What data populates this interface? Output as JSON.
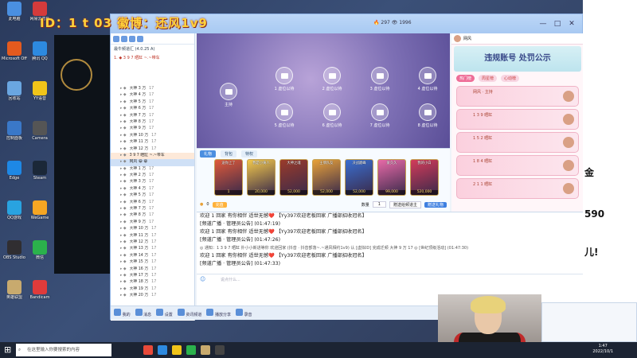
{
  "stream_overlay": {
    "text": "ID：1 t 03 徽博：还风1v9"
  },
  "desktop_icons": [
    {
      "label": "此电脑",
      "color": "#4a8fe0"
    },
    {
      "label": "网易云音乐",
      "color": "#d43b3b"
    },
    {
      "label": "Microsoft Office",
      "color": "#e45a1e"
    },
    {
      "label": "腾讯 QQ",
      "color": "#2d8ae0"
    },
    {
      "label": "回收站",
      "color": "#6aa6e0"
    },
    {
      "label": "YY语音",
      "color": "#f0c419"
    },
    {
      "label": "控制面板",
      "color": "#3a78c8"
    },
    {
      "label": "Camera",
      "color": "#555"
    },
    {
      "label": "Edge",
      "color": "#1e88e5"
    },
    {
      "label": "Steam",
      "color": "#1b2838"
    },
    {
      "label": "QQ游戏",
      "color": "#29a3e0"
    },
    {
      "label": "WeGame",
      "color": "#f5a623"
    },
    {
      "label": "OBS Studio",
      "color": "#302e31"
    },
    {
      "label": "微信",
      "color": "#2bb24c"
    },
    {
      "label": "英雄联盟",
      "color": "#c8aa6e"
    },
    {
      "label": "Bandicam",
      "color": "#e03b3b"
    }
  ],
  "titlebar": {
    "user_info": "🔥 297   👁 1996",
    "btn_min": "—",
    "btn_max": "□",
    "btn_close": "✕"
  },
  "channel": {
    "name": "最牛频道汇 (4.0.25 A)",
    "sub": "1. ◆ 3 9 7 晒缸 ~.~带车"
  },
  "tree_rows": [
    {
      "tag": "大神 3 万",
      "n": "17"
    },
    {
      "tag": "大神 4 万",
      "n": "17"
    },
    {
      "tag": "大神 5 万",
      "n": "17"
    },
    {
      "tag": "大神 6 万",
      "n": "17"
    },
    {
      "tag": "大神 7 万",
      "n": "17"
    },
    {
      "tag": "大神 8 万",
      "n": "17"
    },
    {
      "tag": "大神 9 万",
      "n": "17"
    },
    {
      "tag": "大神 10 万",
      "n": "17"
    },
    {
      "tag": "大神 11 万",
      "n": "17"
    },
    {
      "tag": "大神 12 万",
      "n": "17"
    },
    {
      "tag": "3 9 7 晒缸 ~.~带车",
      "n": "",
      "hl": true
    },
    {
      "tag": "网风 😀 😁",
      "n": "",
      "sel": true
    },
    {
      "tag": "大神 1 万",
      "n": "17"
    },
    {
      "tag": "大神 2 万",
      "n": "17"
    },
    {
      "tag": "大神 3 万",
      "n": "17"
    },
    {
      "tag": "大神 4 万",
      "n": "17"
    },
    {
      "tag": "大神 5 万",
      "n": "17"
    },
    {
      "tag": "大神 6 万",
      "n": "17"
    },
    {
      "tag": "大神 7 万",
      "n": "17"
    },
    {
      "tag": "大神 8 万",
      "n": "17"
    },
    {
      "tag": "大神 9 万",
      "n": "17"
    },
    {
      "tag": "大神 10 万",
      "n": "17"
    },
    {
      "tag": "大神 11 万",
      "n": "17"
    },
    {
      "tag": "大神 12 万",
      "n": "17"
    },
    {
      "tag": "大神 13 万",
      "n": "17"
    },
    {
      "tag": "大神 14 万",
      "n": "17"
    },
    {
      "tag": "大神 15 万",
      "n": "17"
    },
    {
      "tag": "大神 16 万",
      "n": "17"
    },
    {
      "tag": "大神 17 万",
      "n": "17"
    },
    {
      "tag": "大神 18 万",
      "n": "17"
    },
    {
      "tag": "大神 19 万",
      "n": "17"
    },
    {
      "tag": "大神 20 万",
      "n": "17"
    }
  ],
  "seats": [
    {
      "label": "主持"
    },
    {
      "label": "1 虚位以待"
    },
    {
      "label": "2 虚位以待"
    },
    {
      "label": "3 虚位以待"
    },
    {
      "label": "4 虚位以待"
    },
    {
      "label": "5 虚位以待"
    },
    {
      "label": "6 虚位以待"
    },
    {
      "label": "7 虚位以待"
    },
    {
      "label": "8 虚位以待"
    }
  ],
  "gift_tabs": [
    "礼物",
    "背包",
    "特权"
  ],
  "gifts": [
    {
      "name": "送你上了",
      "price": "1",
      "color": "#e05a3a"
    },
    {
      "name": "我是小黄人",
      "price": "20,000",
      "color": "#f2c84b"
    },
    {
      "name": "大神之魂",
      "price": "52,000",
      "color": "#9b3b2a"
    },
    {
      "name": "王牌队友",
      "price": "52,000",
      "color": "#e8a23a"
    },
    {
      "name": "决战巅峰",
      "price": "52,000",
      "color": "#3a6fd0"
    },
    {
      "name": "爱久久",
      "price": "99,000",
      "color": "#e86aa8"
    },
    {
      "name": "我的小白",
      "price": "520,000",
      "color": "#d43b5a"
    }
  ],
  "gift_bottom": {
    "balance": "0",
    "recharge": "充值",
    "qty_label": "数量",
    "qty_value": "1",
    "target": "赠送给频道主",
    "send": "赠送礼物"
  },
  "right_panel": {
    "user": "网风",
    "banner": "违规账号 处罚公示",
    "tabs": [
      "热门榜",
      "周星榜",
      "心动榜"
    ],
    "cards": [
      "网风 · 主持",
      "1 3 9 晒缸",
      "1 5 2 晒缸",
      "1 8 4 晒缸",
      "2 1 1 晒缸"
    ]
  },
  "chat": [
    {
      "type": "welcome",
      "text": "欢迎 1 回家 有你相伴 适世无憾❤️     【Yy397欢迎老板回家 广播部招收冠名】",
      "sub": "[频道广播 · 管理员公告] (01:47:19)"
    },
    {
      "type": "welcome",
      "text": "欢迎 1 回家 有你相伴 适世无憾❤️     【Yy397欢迎老板回家 广播部招收冠名】",
      "sub": "[频道广播 · 管理员公告] (01:47:26)"
    },
    {
      "type": "sys",
      "text": "◎ 通知：1 3 9 7 晒缸 扑小小新进等你 欢迎回家 (抖音 · 抖音部落~.~通风相约1v9) 认 [虚拟ID]  完成迁频  大神 9 万 17  ◎ [世纪顶级活动] (01:47:30)"
    },
    {
      "type": "welcome",
      "text": "欢迎 1 回家 有你相伴 适世无憾❤️     【Yy397欢迎老板回家 广播部招收冠名】",
      "sub": "[频道广播 · 管理员公告] (01:47:33)"
    }
  ],
  "input": {
    "placeholder": "说点什么..."
  },
  "bottombar": [
    "我的",
    "消息",
    "设置",
    "资讯频道",
    "播放分享",
    "录音"
  ],
  "right_win": {
    "lines": [
      "金",
      "590",
      "儿!"
    ]
  },
  "taskbar": {
    "search": "在这里输入你要搜索的内容",
    "time": "1:47",
    "date": "2022/10/1"
  }
}
